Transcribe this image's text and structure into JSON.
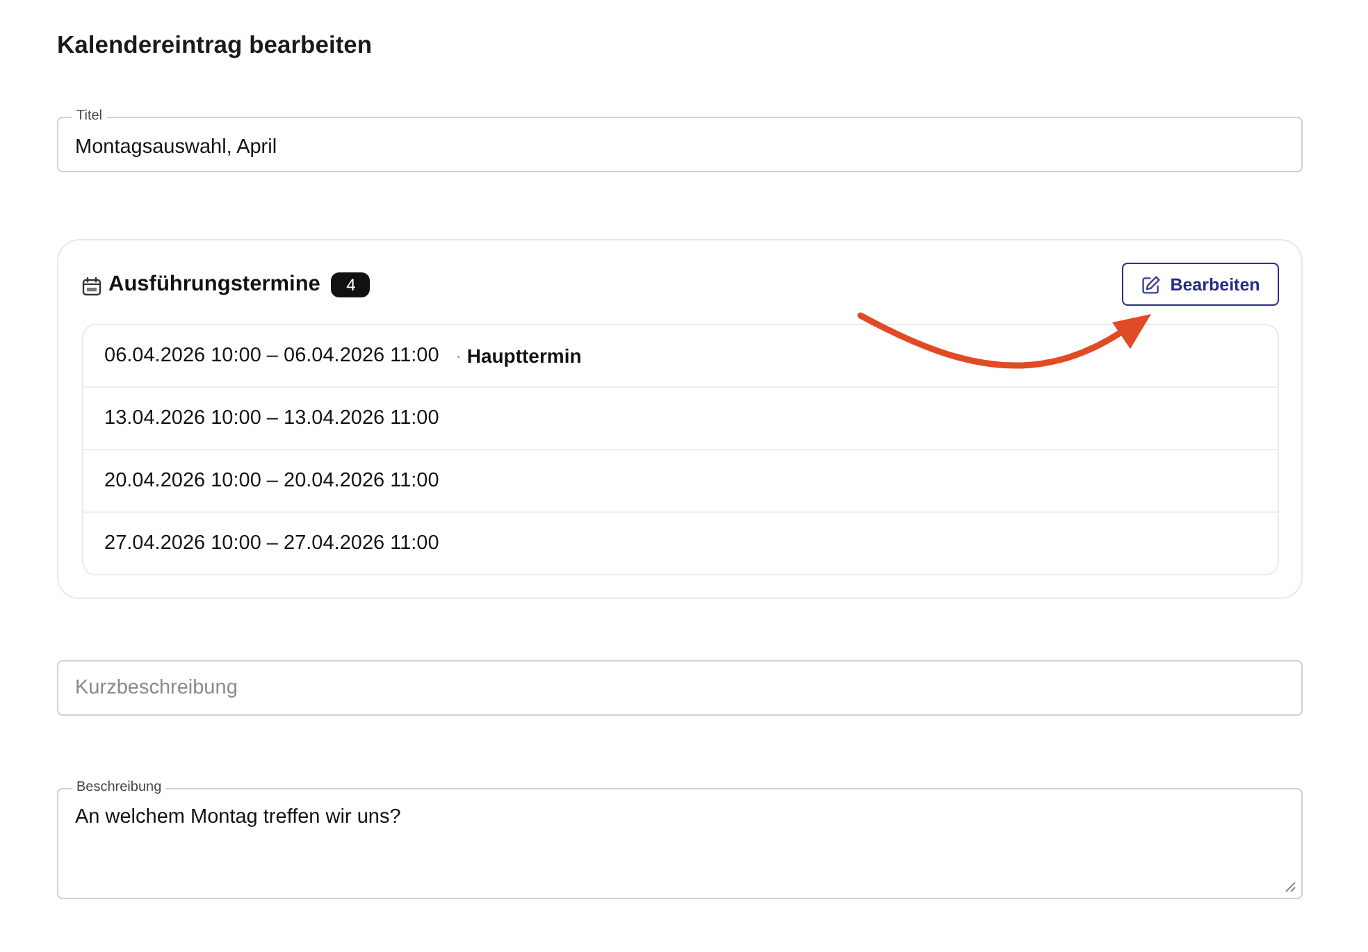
{
  "heading": "Kalendereintrag bearbeiten",
  "title_field": {
    "label": "Titel",
    "value": "Montagsauswahl, April"
  },
  "schedule": {
    "title": "Ausführungstermine",
    "count": "4",
    "edit_button": "Bearbeiten",
    "dates": [
      {
        "range": "06.04.2026 10:00 – 06.04.2026 11:00",
        "separator": "·",
        "note": "Haupttermin"
      },
      {
        "range": "13.04.2026 10:00 – 13.04.2026 11:00"
      },
      {
        "range": "20.04.2026 10:00 – 20.04.2026 11:00"
      },
      {
        "range": "27.04.2026 10:00 – 27.04.2026 11:00"
      }
    ]
  },
  "short_description": {
    "placeholder": "Kurzbeschreibung"
  },
  "description": {
    "label": "Beschreibung",
    "value": "An welchem Montag treffen wir uns?"
  }
}
